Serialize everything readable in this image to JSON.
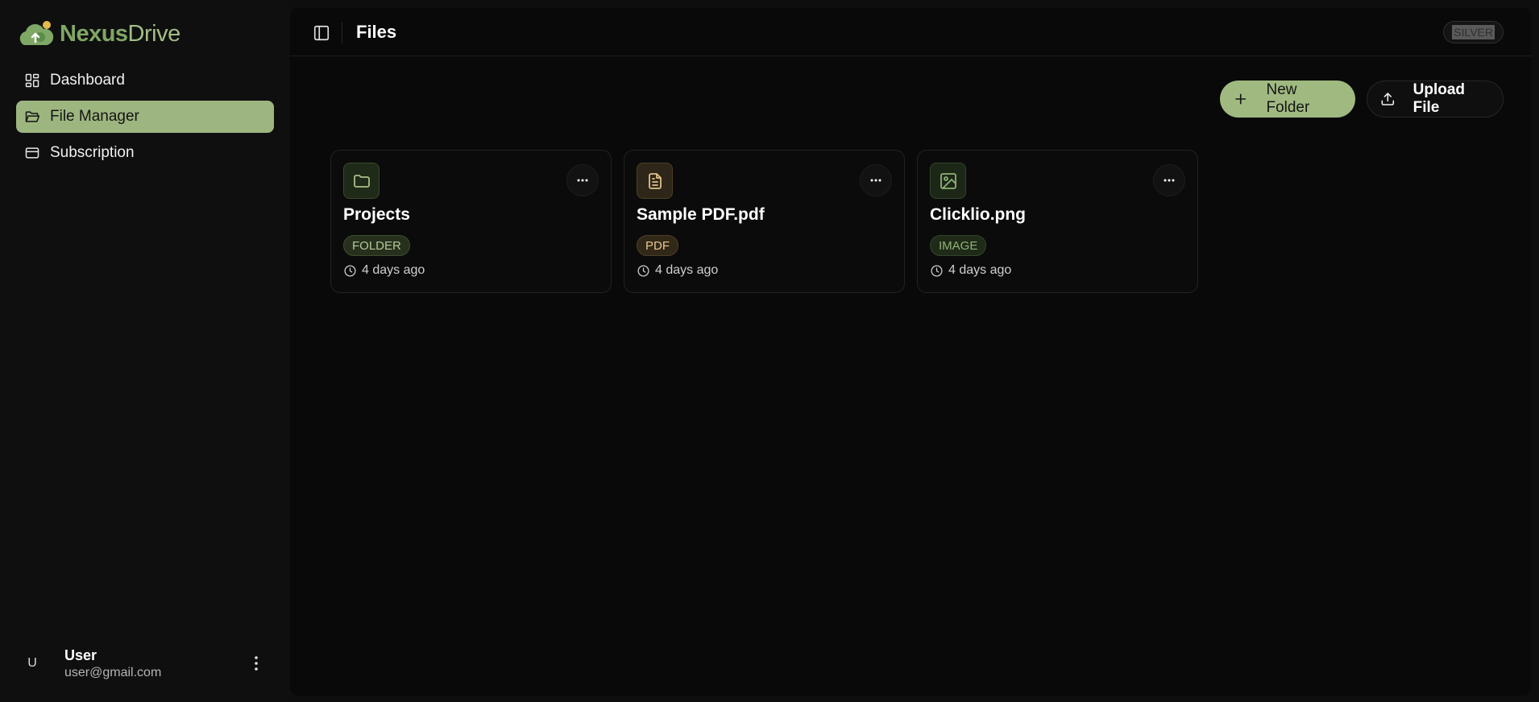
{
  "brand": {
    "name_part1": "Nexus",
    "name_part2": "Drive"
  },
  "nav": {
    "items": [
      {
        "label": "Dashboard",
        "icon": "dashboard-icon",
        "active": false
      },
      {
        "label": "File Manager",
        "icon": "folder-open-icon",
        "active": true
      },
      {
        "label": "Subscription",
        "icon": "credit-card-icon",
        "active": false
      }
    ]
  },
  "user": {
    "initial": "U",
    "name": "User",
    "email": "user@gmail.com"
  },
  "header": {
    "title": "Files",
    "plan": "SILVER"
  },
  "actions": {
    "new_folder": "New Folder",
    "upload_file": "Upload File"
  },
  "files": [
    {
      "name": "Projects",
      "type": "FOLDER",
      "time": "4 days ago",
      "icon": "folder-icon",
      "accent": "#a8c08a"
    },
    {
      "name": "Sample PDF.pdf",
      "type": "PDF",
      "time": "4 days ago",
      "icon": "file-text-icon",
      "accent": "#e0c08a"
    },
    {
      "name": "Clicklio.png",
      "type": "IMAGE",
      "time": "4 days ago",
      "icon": "image-icon",
      "accent": "#8fb374"
    }
  ],
  "colors": {
    "accent": "#9db67f",
    "background": "#090909"
  }
}
